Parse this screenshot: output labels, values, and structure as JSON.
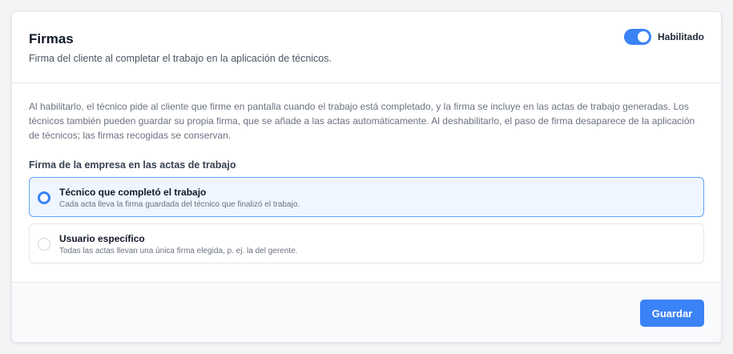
{
  "header": {
    "title": "Firmas",
    "subtitle": "Firma del cliente al completar el trabajo en la aplicación de técnicos.",
    "toggle": {
      "label": "Habilitado",
      "on": true
    }
  },
  "body": {
    "description": "Al habilitarlo, el técnico pide al cliente que firme en pantalla cuando el trabajo está completado, y la firma se incluye en las actas de trabajo generadas. Los técnicos también pueden guardar su propia firma, que se añade a las actas automáticamente. Al deshabilitarlo, el paso de firma desaparece de la aplicación de técnicos; las firmas recogidas se conservan.",
    "section_label": "Firma de la empresa en las actas de trabajo",
    "options": [
      {
        "title": "Técnico que completó el trabajo",
        "description": "Cada acta lleva la firma guardada del técnico que finalizó el trabajo.",
        "selected": true
      },
      {
        "title": "Usuario específico",
        "description": "Todas las actas llevan una única firma elegida, p. ej. la del gerente.",
        "selected": false
      }
    ]
  },
  "footer": {
    "save_label": "Guardar"
  },
  "colors": {
    "accent": "#3b82f6",
    "selected_bg": "#eff6ff"
  }
}
